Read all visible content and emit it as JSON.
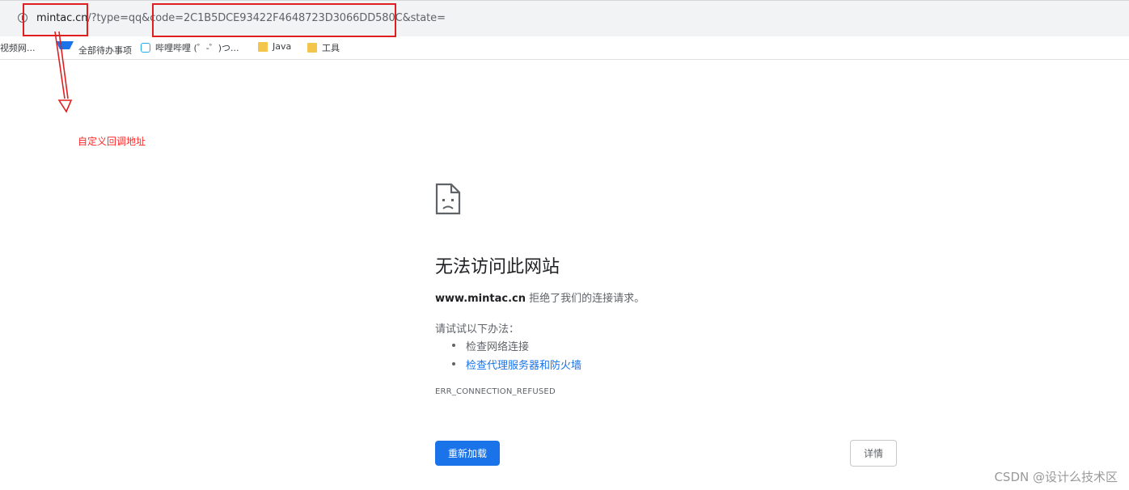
{
  "address_bar": {
    "host": "mintac.cn",
    "rest": "/?type=qq&code=2C1B5DCE93422F4648723D3066DD580C&state="
  },
  "bookmarks": [
    {
      "label": "视频网...",
      "icon": "bookmark-icon"
    },
    {
      "label": "全部待办事项",
      "icon": "todo-icon"
    },
    {
      "label": "哔哩哔哩 (゜-゜)つ...",
      "icon": "bilibili-icon"
    },
    {
      "label": "Java",
      "icon": "folder-icon"
    },
    {
      "label": "工具",
      "icon": "folder-icon"
    }
  ],
  "annotation": {
    "label": "自定义回调地址",
    "color": "#ff2a2a"
  },
  "error_page": {
    "icon": "sad-page-icon",
    "title": "无法访问此网站",
    "host": "www.mintac.cn",
    "message": " 拒绝了我们的连接请求。",
    "try_label": "请试试以下办法：",
    "suggestions": [
      "检查网络连接",
      "检查代理服务器和防火墙"
    ],
    "error_code": "ERR_CONNECTION_REFUSED",
    "reload_label": "重新加载",
    "details_label": "详情"
  },
  "watermark": "CSDN @设计么技术区",
  "colors": {
    "accent": "#1a73e8",
    "annotation": "#e02020"
  }
}
